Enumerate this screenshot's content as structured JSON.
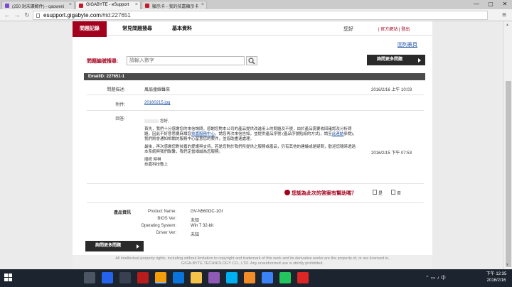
{
  "browser": {
    "tabs": [
      {
        "title": "(250 封未讀郵件) - qaoweni",
        "icon_color": "#7a4ad0"
      },
      {
        "title": "GIGABYTE - eSupport",
        "icon_color": "#c41a2c",
        "active": true
      },
      {
        "title": "顯示卡 - 我的技嘉顯示卡",
        "icon_color": "#c41a2c"
      }
    ],
    "url_host": "esupport.gigabyte.com",
    "url_path": "/#id:227651",
    "window_buttons": [
      "—",
      "▢",
      "✕"
    ]
  },
  "site": {
    "nav": {
      "active_tab": "問題記錄",
      "tab_faq": "常見問題搜尋",
      "tab_profile": "基本資料",
      "greeting": "您好",
      "links": "| 官方網站 | 登出"
    },
    "back_link": "回列表頁",
    "search": {
      "label": "問題編號搜尋:",
      "placeholder": "請輸入數字"
    },
    "more_questions_label": "詢問更多問題",
    "email_id": "EmailID: 227651-1",
    "subject": {
      "label": "問題描述:",
      "value": "風扇撞線聲來",
      "date": "2016/2/16 上午 10:03"
    },
    "attachment": {
      "label": "附件:",
      "file": "20160215.jpg"
    },
    "reply": {
      "label": "回答:",
      "salutation": "您好,",
      "p1_a": "首先，我們十分感謝您的來信詢問，感謝您對本公司的產品提供改進用上的問題及不便，由於產品需要收回確認及分析問題，因此不好意思要麻煩您",
      "p1_link1": "技嘉服務中心",
      "p1_b": "，請您再次來信告知，並提供產品序號 (產品序號貼紙的方式)，請至",
      "p1_link2": "此連結",
      "p1_c": "參閱)，我們將會通知相關的服務中心留意您的案件，並協助盡速處理。",
      "p2": "最後，再次感謝您對技嘉的愛護與支持，若是您對於我們所提供之服務或產品，仍有其他的建議或是疑問，歡迎您隨時透過本系統與我們聯繫，我們定當竭誠為您服務。",
      "sign1": "順祝 時祺",
      "sign2": "技嘉科技敬上",
      "date": "2016/2/15 下午 07:53"
    },
    "helpful": {
      "question": "您認為此次的答案有幫助嗎？",
      "yes": "是",
      "no": "否"
    },
    "product": {
      "heading": "產品資訊",
      "rows": [
        {
          "label": "Product Name:",
          "value": "GV-N560OC-1GI"
        },
        {
          "label": "BIOS Ver:",
          "value": "未知"
        },
        {
          "label": "Operating System:",
          "value": "Win 7 32-bit"
        },
        {
          "label": "Driver Ver:",
          "value": "未知"
        }
      ]
    },
    "footer": {
      "line1": "All intellectual property rights, including without limitation to copyright and trademark of this work and its derivative works are the property of, or are licensed to,",
      "line2": "GIGA-BYTE TECHNOLOGY CO., LTD. Any unauthorized use is strictly prohibited."
    }
  },
  "taskbar": {
    "icons": [
      {
        "name": "task-view-icon",
        "color": "#4b5563"
      },
      {
        "name": "store-icon",
        "color": "#2563eb"
      },
      {
        "name": "terminal-icon",
        "color": "#374151"
      },
      {
        "name": "flash-icon",
        "color": "#b91c1c"
      },
      {
        "name": "chrome-icon",
        "color": "#f59e0b",
        "running": true
      },
      {
        "name": "edge-icon",
        "color": "#0a74da"
      },
      {
        "name": "explorer-icon",
        "color": "#f5c24a"
      },
      {
        "name": "onenote-icon",
        "color": "#8e5ab5"
      },
      {
        "name": "skype-icon",
        "color": "#00aff0"
      },
      {
        "name": "rss-icon",
        "color": "#f28c28"
      },
      {
        "name": "upload-icon",
        "color": "#3b82f6"
      },
      {
        "name": "line-icon",
        "color": "#22c55e"
      },
      {
        "name": "app-red-icon",
        "color": "#dc2626"
      }
    ],
    "tray_glyphs": "⌃ ▭ ♪ 中",
    "clock_time": "下午 12:35",
    "clock_date": "2016/2/16"
  }
}
